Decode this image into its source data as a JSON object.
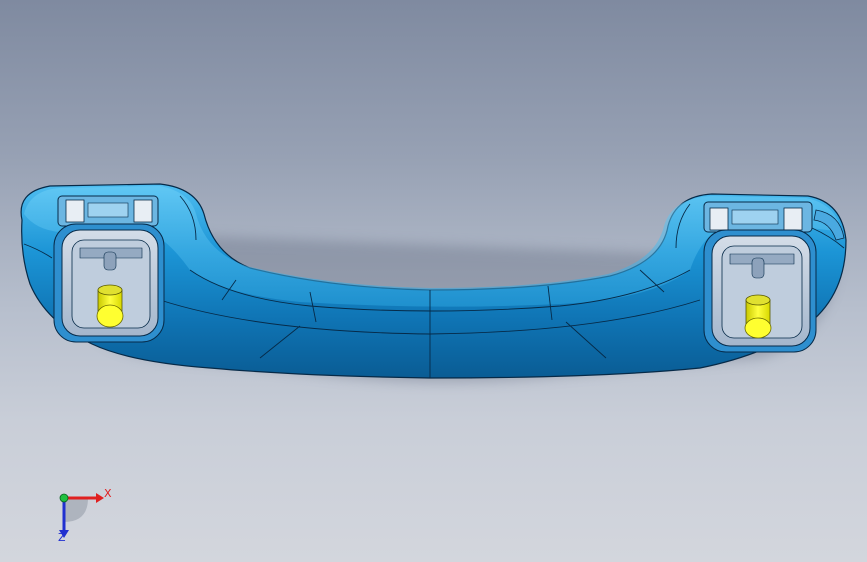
{
  "viewport": {
    "background_top": "#7f8aa0",
    "background_bottom": "#d3d6dd"
  },
  "model": {
    "body_color": "#1a8fd0",
    "body_highlight": "#5cc4f2",
    "bracket_color": "#b8c8dc",
    "pin_color": "#ffff22",
    "parts": [
      "handle-body",
      "left-bracket",
      "right-bracket",
      "left-pin",
      "right-pin",
      "left-clip",
      "right-clip"
    ]
  },
  "triad": {
    "x_label": "X",
    "z_label": "Z",
    "x_color": "#e02020",
    "y_color": "#20c040",
    "z_color": "#2030d0",
    "icons": [
      "x-axis-arrow",
      "y-axis-dot",
      "z-axis-arrow"
    ]
  }
}
